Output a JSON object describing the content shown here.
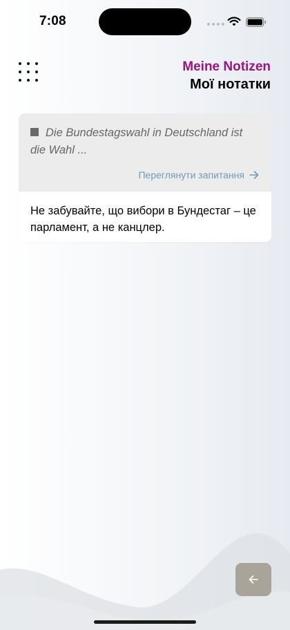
{
  "status_bar": {
    "time": "7:08"
  },
  "header": {
    "title_de": "Meine Notizen",
    "title_uk": "Мої нотатки"
  },
  "notes": [
    {
      "question": "Die Bundestagswahl in Deutschland ist die Wahl ...",
      "link_label": "Переглянути запитання",
      "note_text": "Не забувайте, що вибори в Бундестаг – це парламент, а не канцлер."
    }
  ],
  "colors": {
    "title_accent": "#9a1482",
    "link": "#6e9bb5",
    "back_button": "#a8a49a"
  },
  "icons": {
    "menu": "grid-dots-icon",
    "question_marker": "square-icon",
    "link_arrow": "arrow-right-icon",
    "back": "arrow-left-icon"
  }
}
